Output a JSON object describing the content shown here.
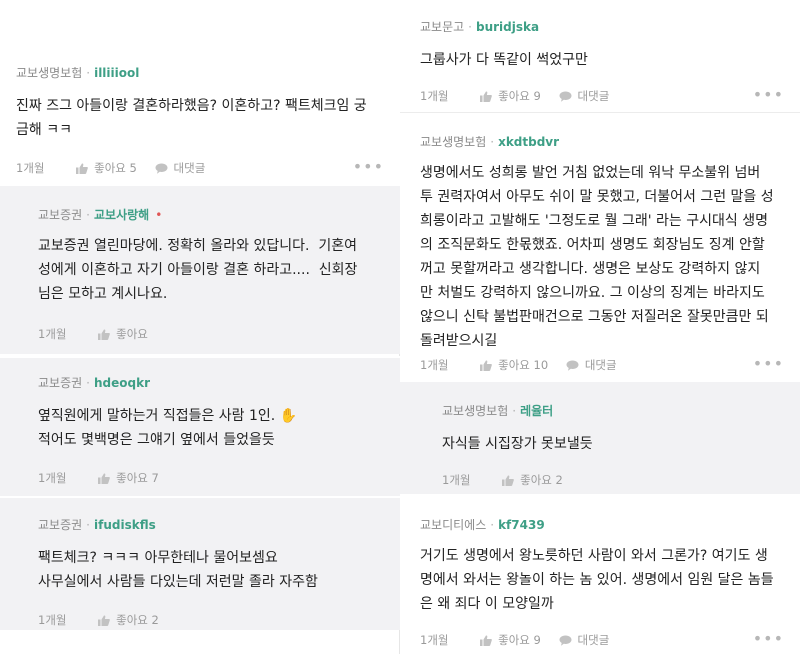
{
  "labels": {
    "like": "좋아요",
    "reply": "대댓글",
    "more": "•••"
  },
  "left": [
    {
      "company": "교보생명보험",
      "author": "illiiiool",
      "text": "진짜 즈그 아들이랑 결혼하라했음? 이혼하고? 팩트체크임 궁\n금해 ㅋㅋ",
      "time": "1개월",
      "likes": "5",
      "reply": true
    },
    {
      "company": "교보증권",
      "author": "교보사랑해",
      "mark": "•",
      "text": "교보증권 열린마당에. 정확히 올라와 있답니다.  기혼여\n성에게 이혼하고 자기 아들이랑 결혼 하라고....  신회장\n님은 모하고 계시나요.",
      "time": "1개월",
      "likes": "",
      "reply": false
    },
    {
      "company": "교보증권",
      "author": "hdeoqkr",
      "text": "옆직원에게 말하는거 직접들은 사람 1인. ✋\n적어도 몇백명은 그얘기 옆에서 들었을듯",
      "time": "1개월",
      "likes": "7",
      "reply": false
    },
    {
      "company": "교보증권",
      "author": "ifudiskfls",
      "text": "팩트체크? ㅋㅋㅋ 아무한테나 물어보셈요\n사무실에서 사람들 다있는데 저런말 졸라 자주함",
      "time": "1개월",
      "likes": "2",
      "reply": false
    }
  ],
  "right": [
    {
      "company": "교보문고",
      "author": "buridjska",
      "text": "그룹사가 다 똑같이 썩었구만",
      "time": "1개월",
      "likes": "9",
      "reply": true
    },
    {
      "company": "교보생명보험",
      "author": "xkdtbdvr",
      "text": "생명에서도 성희롱 발언 거침 없었는데 워낙 무소불위 넘버\n투 권력자여서 아무도 쉬이 말 못했고, 더불어서 그런 말을 성\n희롱이라고 고발해도 '그정도로 뭘 그래' 라는 구시대식 생명\n의 조직문화도 한몫했죠. 어차피 생명도 회장님도 징계 안할\n꺼고 못할꺼라고 생각합니다. 생명은 보상도 강력하지 않지\n만 처벌도 강력하지 않으니까요. 그 이상의 징계는 바라지도\n않으니 신탁 불법판매건으로 그동안 저질러온 잘못만큼만 되\n돌려받으시길",
      "time": "1개월",
      "likes": "10",
      "reply": true
    },
    {
      "company": "교보생명보험",
      "author": "레율터",
      "text": "자식들 시집장가 못보낼듯",
      "time": "1개월",
      "likes": "2",
      "reply": false
    },
    {
      "company": "교보디티에스",
      "author": "kf7439",
      "text": "거기도 생명에서 왕노릇하던 사람이 와서 그론가? 여기도 생\n명에서 와서는 왕놀이 하는 놈 있어. 생명에서 임원 달은 놈들\n은 왜 죄다 이 모양일까",
      "time": "1개월",
      "likes": "9",
      "reply": true
    }
  ]
}
